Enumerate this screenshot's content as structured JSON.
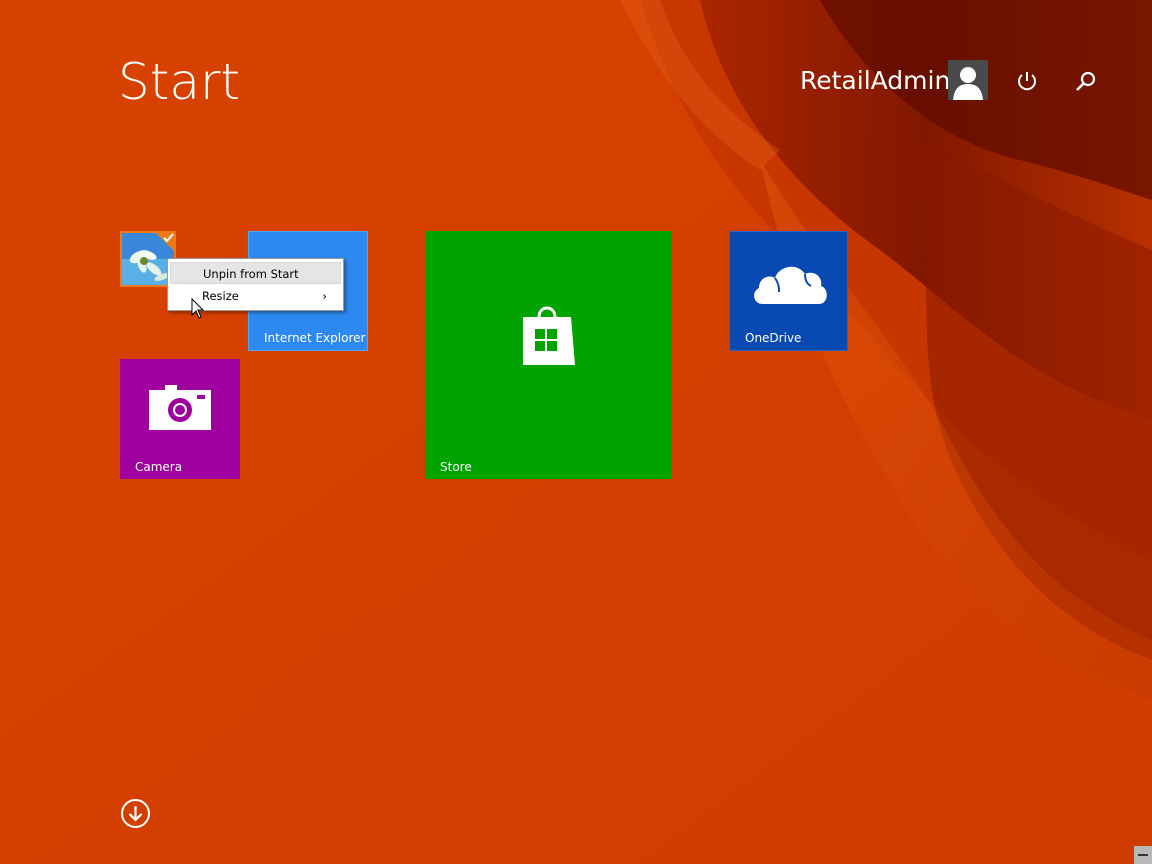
{
  "start": {
    "title": "Start"
  },
  "user": {
    "name": "RetailAdmin",
    "avatar_icon": "user-silhouette-icon"
  },
  "header": {
    "power_icon": "power-icon",
    "search_icon": "search-icon"
  },
  "tiles": {
    "photos": {
      "label": "",
      "selected": true,
      "icon": "photos-icon"
    },
    "internet_explorer": {
      "label": "Internet Explorer",
      "icon": "internet-explorer-icon"
    },
    "store": {
      "label": "Store",
      "icon": "store-bag-icon"
    },
    "onedrive": {
      "label": "OneDrive",
      "icon": "cloud-icon"
    },
    "camera": {
      "label": "Camera",
      "icon": "camera-icon"
    }
  },
  "context_menu": {
    "items": [
      {
        "label": "Unpin from Start",
        "highlighted": true
      },
      {
        "label": "Resize",
        "has_submenu": true,
        "arrow": "›"
      }
    ]
  },
  "footer": {
    "all_apps_icon": "down-arrow-circle-icon"
  },
  "colors": {
    "background": "#d64000",
    "ie": "#2d89ef",
    "store": "#00a300",
    "onedrive": "#094ab2",
    "camera": "#a0009e",
    "selection": "#f07a14"
  }
}
